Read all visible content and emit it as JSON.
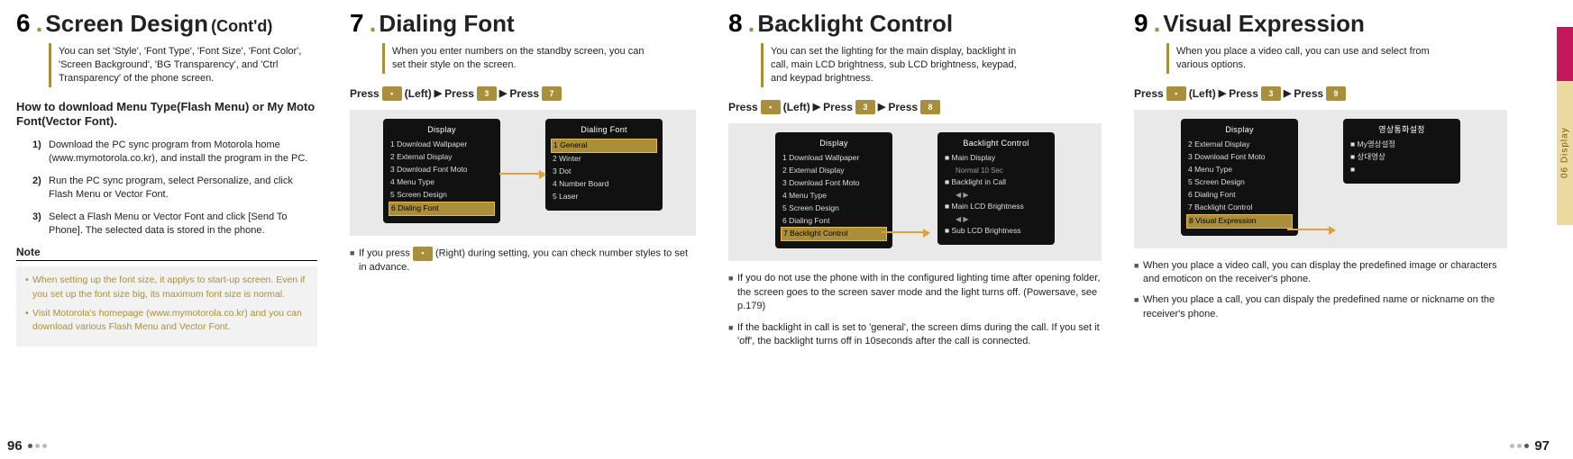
{
  "sidetab": {
    "chapter": "06  Display"
  },
  "page_left": "96",
  "page_right": "97",
  "s6": {
    "num": "6",
    "title": "Screen Design",
    "suffix": "(Cont'd)",
    "lead": "You can set 'Style', 'Font Type', 'Font Size', 'Font Color', 'Screen Background', 'BG Transparency', and 'Ctrl Transparency' of the phone screen.",
    "subhead": "How to download Menu Type(Flash Menu) or My Moto Font(Vector Font).",
    "step1_n": "1)",
    "step1_t": "Download the PC sync program from Motorola home (www.mymotorola.co.kr), and install the program in the PC.",
    "step2_n": "2)",
    "step2_t": "Run the PC sync program, select Personalize, and click Flash Menu or Vector Font.",
    "step3_n": "3)",
    "step3_t": "Select a Flash Menu or Vector Font and click [Send To Phone]. The selected data is stored in the phone.",
    "note_label": "Note",
    "note1": "When setting up the font size, it applys to start-up screen. Even if you set up the font size big, its maximum font size is normal.",
    "note2": "Visit Motorola's homepage (www.mymotorola.co.kr) and you can download various Flash Menu and Vector Font."
  },
  "s7": {
    "num": "7",
    "title": "Dialing Font",
    "lead": "When you enter numbers on the standby screen, you can set their style on the screen.",
    "press1": "Press",
    "left": "(Left)",
    "press2": "Press",
    "press3": "Press",
    "key_center": "•",
    "key_3": "3",
    "key_7": "7",
    "bullet1_a": "If you press ",
    "bullet1_b": " (Right) during setting, you can check number styles to set in advance.",
    "phoneL_title": "Display",
    "phoneL_r1": "1 Download Wallpaper",
    "phoneL_r2": "2 External Display",
    "phoneL_r3": "3 Download Font Moto",
    "phoneL_r4": "4 Menu Type",
    "phoneL_r5": "5 Screen Design",
    "phoneL_r6": "6 Dialing Font",
    "phoneR_title": "Dialing Font",
    "phoneR_r1": "1 General",
    "phoneR_r2": "2 Winter",
    "phoneR_r3": "3 Dot",
    "phoneR_r4": "4 Number Board",
    "phoneR_r5": "5 Laser"
  },
  "s8": {
    "num": "8",
    "title": "Backlight Control",
    "lead": "You can set the lighting for the main display, backlight in call, main LCD brightness, sub LCD brightness, keypad, and keypad brightness.",
    "press1": "Press",
    "left": "(Left)",
    "press2": "Press",
    "press3": "Press",
    "key_center": "•",
    "key_3": "3",
    "key_8": "8",
    "phoneL_title": "Display",
    "phoneL_r1": "1 Download Wallpaper",
    "phoneL_r2": "2 External Display",
    "phoneL_r3": "3 Download Font Moto",
    "phoneL_r4": "4 Menu Type",
    "phoneL_r5": "5 Screen Design",
    "phoneL_r6": "6 Dialing Font",
    "phoneL_r7": "7 Backlight Control",
    "phoneR_title": "Backlight Control",
    "phoneR_r1": "■ Main Display",
    "phoneR_r1s": "Normal 10 Sec",
    "phoneR_r2": "■ Backlight in Call",
    "phoneR_r3": "■ Main LCD Brightness",
    "phoneR_r4": "■ Sub LCD Brightness",
    "b1": "If you do not use the phone with in the configured lighting time after opening folder, the screen goes to the screen saver mode and the light turns off. (Powersave, see p.179)",
    "b2": "If the backlight in call is set to 'general', the screen dims during the call. If you set it 'off', the backlight turns off in 10seconds after the call is connected."
  },
  "s9": {
    "num": "9",
    "title": "Visual Expression",
    "lead": "When you place a video call, you can use and select from various options.",
    "press1": "Press",
    "left": "(Left)",
    "press2": "Press",
    "press3": "Press",
    "key_center": "•",
    "key_3": "3",
    "key_9": "9",
    "phoneL_title": "Display",
    "phoneL_r1": "2 External Display",
    "phoneL_r2": "3 Download Font Moto",
    "phoneL_r3": "4 Menu Type",
    "phoneL_r4": "5 Screen Design",
    "phoneL_r5": "6 Dialing Font",
    "phoneL_r6": "7 Backlight Control",
    "phoneL_r7": "8 Visual Expression",
    "phoneR_title": "영상통화설정",
    "phoneR_r1": "■ My영상설정",
    "phoneR_r2": "■ 상대영상",
    "phoneR_r3": "■ ",
    "b1": "When you place a video call, you can display the predefined image or characters and emoticon on the receiver's phone.",
    "b2": "When you place a call, you can dispaly the predefined name or nickname on the receiver's phone."
  }
}
